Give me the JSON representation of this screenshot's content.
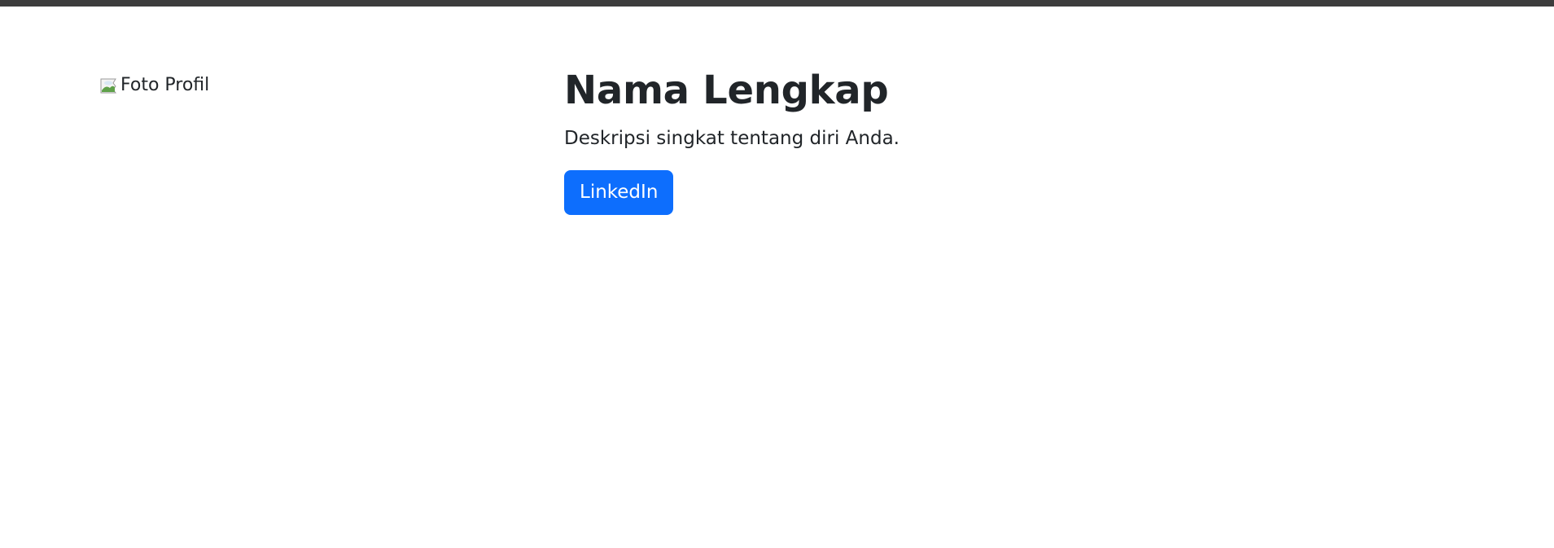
{
  "profile": {
    "photo_alt": "Foto Profil",
    "name": "Nama Lengkap",
    "description": "Deskripsi singkat tentang diri Anda.",
    "linkedin_label": "LinkedIn"
  },
  "icons": {
    "photo": "broken-image-icon"
  },
  "colors": {
    "top_bar": "#3d3d3d",
    "button_bg": "#0d6efd",
    "text": "#212529"
  }
}
